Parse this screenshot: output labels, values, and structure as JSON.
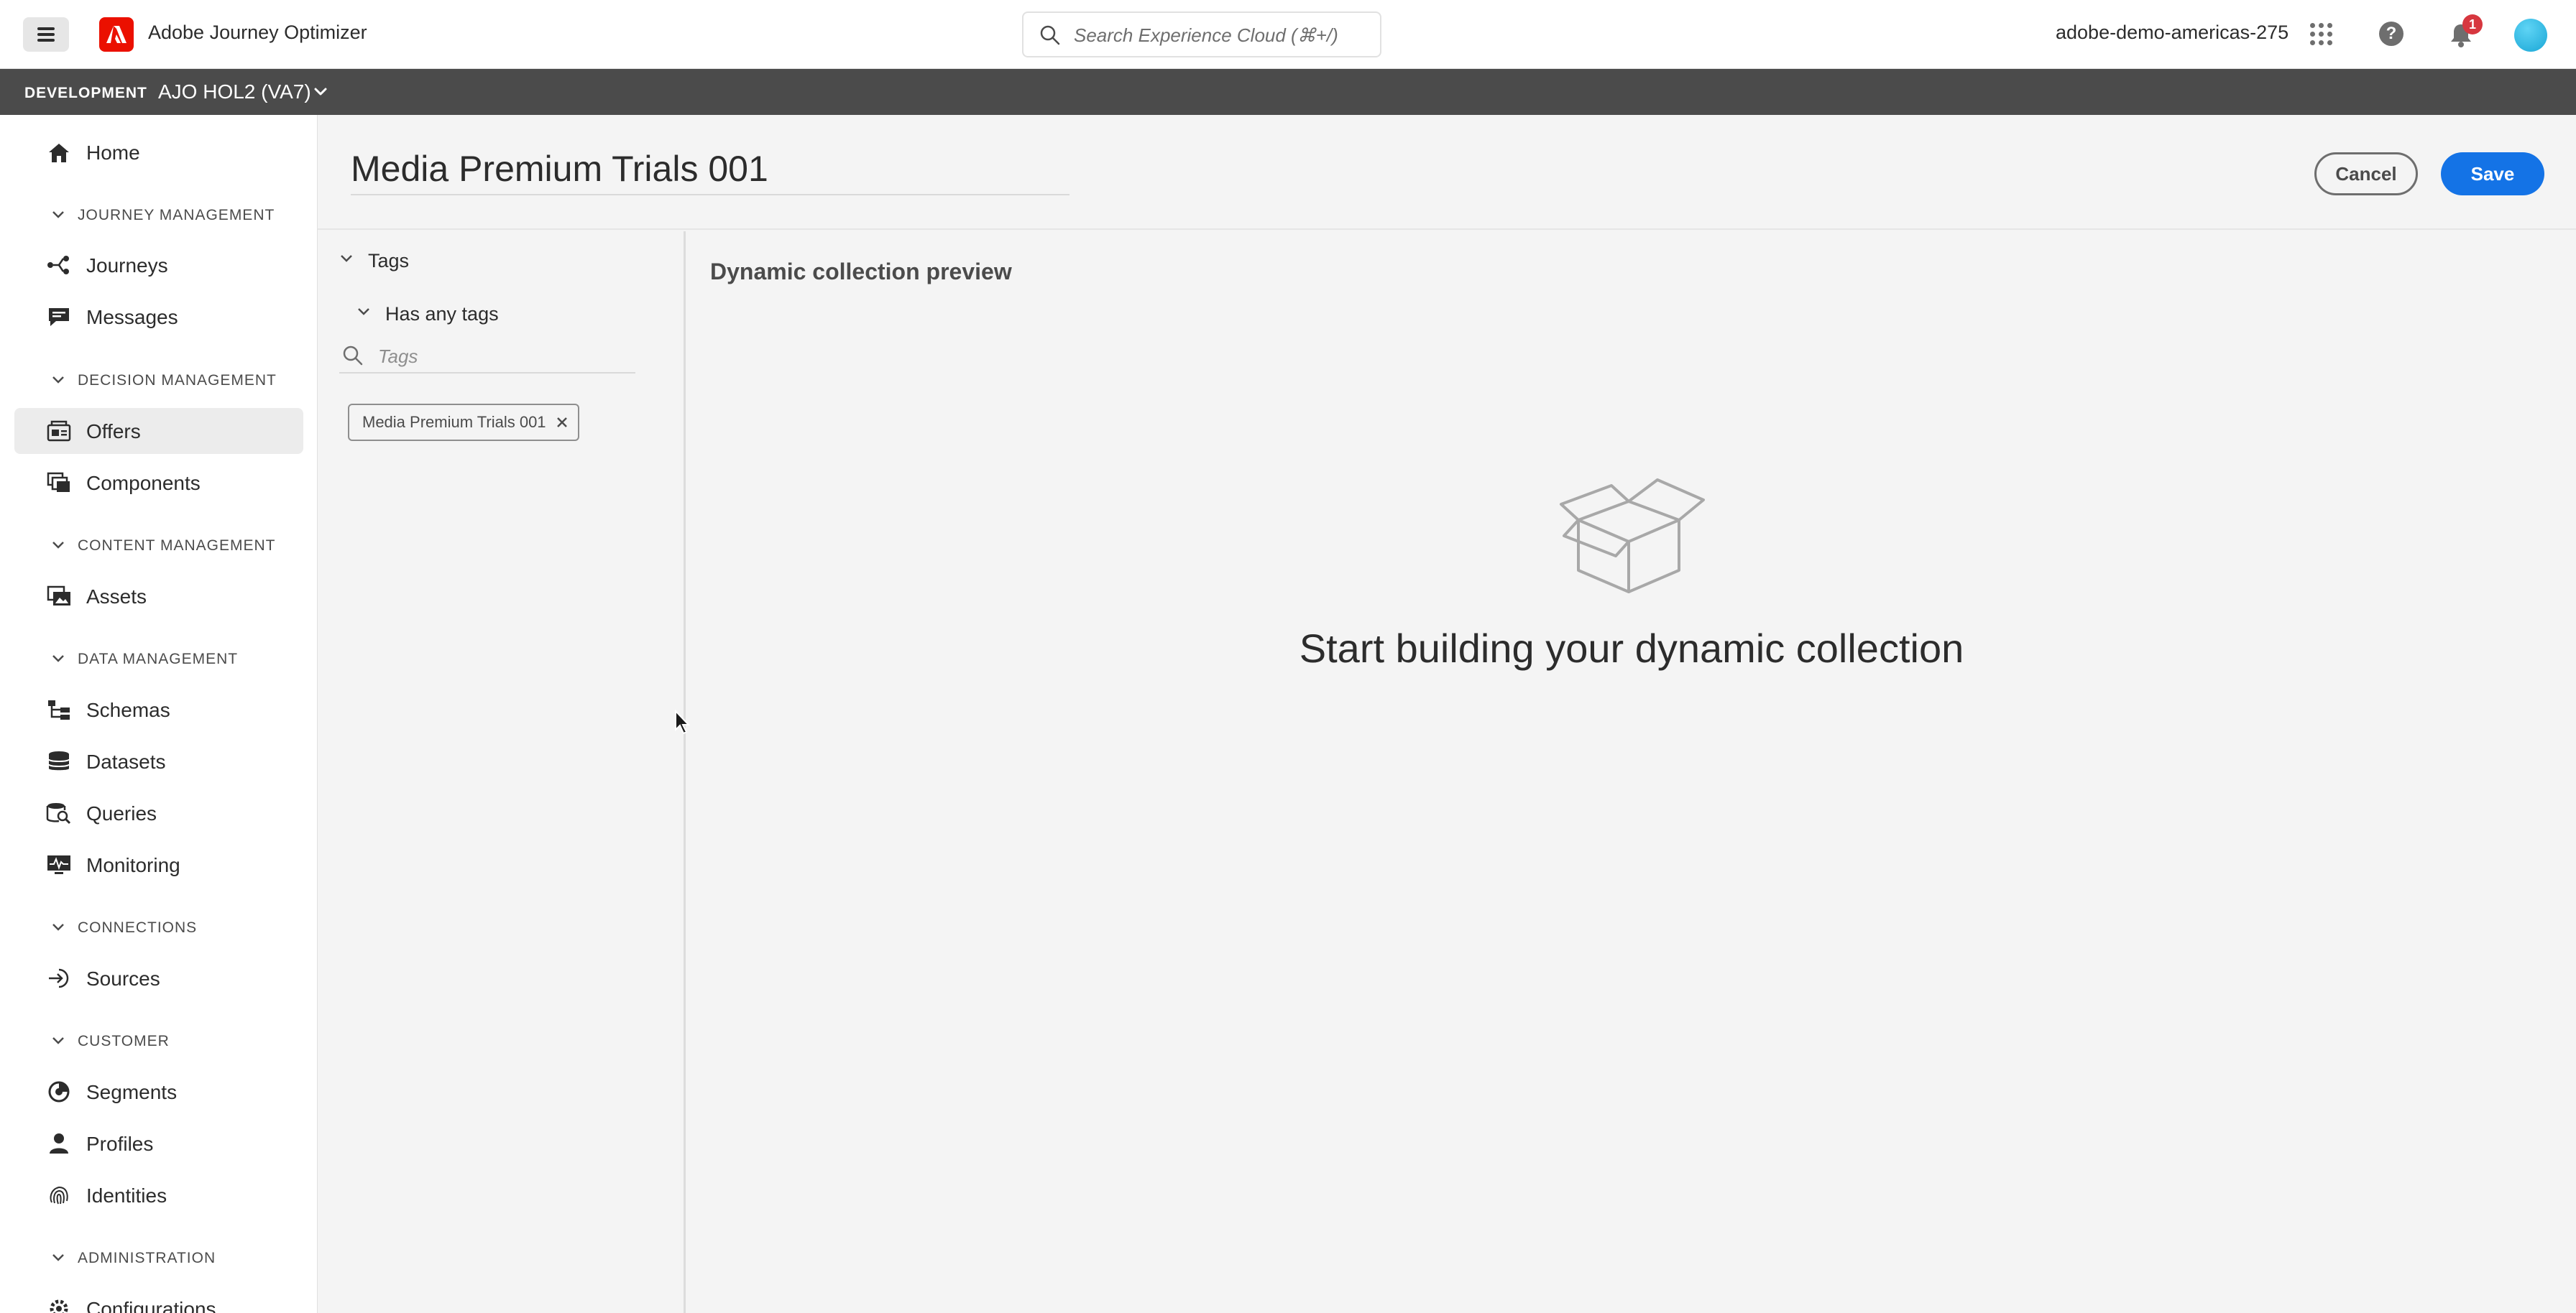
{
  "topbar": {
    "app_title": "Adobe Journey Optimizer",
    "search_placeholder": "Search Experience Cloud (⌘+/)",
    "org_name": "adobe-demo-americas-275",
    "notification_count": "1"
  },
  "envbar": {
    "environment": "DEVELOPMENT",
    "sandbox": "AJO HOL2 (VA7)"
  },
  "nav": {
    "home": "Home",
    "sections": {
      "journey_management": "JOURNEY MANAGEMENT",
      "decision_management": "DECISION MANAGEMENT",
      "content_management": "CONTENT MANAGEMENT",
      "data_management": "DATA MANAGEMENT",
      "connections": "CONNECTIONS",
      "customer": "CUSTOMER",
      "administration": "ADMINISTRATION"
    },
    "items": {
      "journeys": "Journeys",
      "messages": "Messages",
      "offers": "Offers",
      "components": "Components",
      "assets": "Assets",
      "schemas": "Schemas",
      "datasets": "Datasets",
      "queries": "Queries",
      "monitoring": "Monitoring",
      "sources": "Sources",
      "segments": "Segments",
      "profiles": "Profiles",
      "identities": "Identities",
      "configurations": "Configurations"
    }
  },
  "header": {
    "title": "Media Premium Trials 001",
    "cancel_label": "Cancel",
    "save_label": "Save"
  },
  "filters": {
    "tags_label": "Tags",
    "condition_label": "Has any tags",
    "search_placeholder": "Tags",
    "selected_tag": "Media Premium Trials 001"
  },
  "preview": {
    "title": "Dynamic collection preview",
    "empty_message": "Start building your dynamic collection"
  },
  "colors": {
    "accent": "#1473e6",
    "adobe_red": "#eb1000",
    "env_bar": "#4b4b4b",
    "badge": "#d7373f"
  }
}
